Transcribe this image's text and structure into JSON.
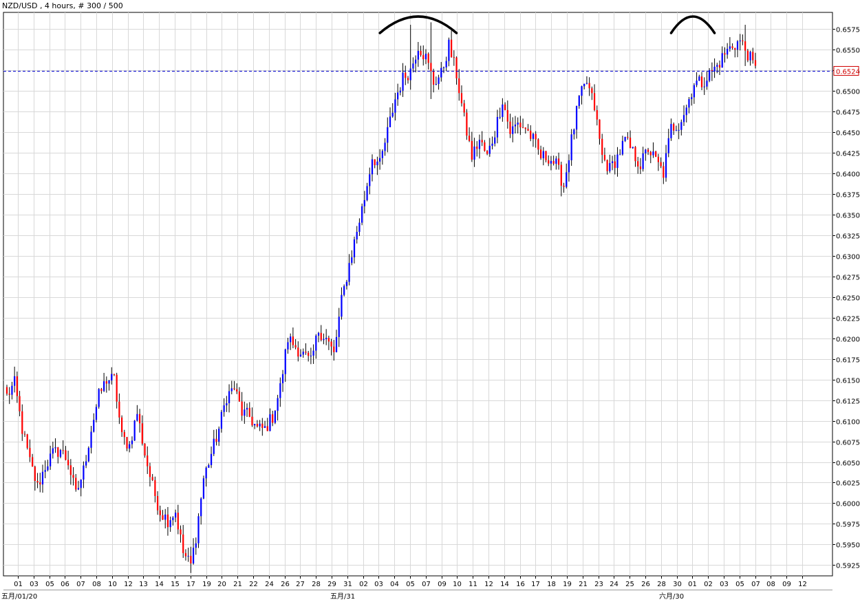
{
  "header": {
    "title": "NZD/USD , 4 hours, # 300 / 500"
  },
  "colors": {
    "background": "#ffffff",
    "grid": "#d8d8d8",
    "bull": "#0000ff",
    "bear": "#ff0000",
    "wick": "#000000",
    "price_line": "#0000cc",
    "price_label": "#d00000",
    "annotation": "#000000"
  },
  "chart_data": {
    "type": "candlestick",
    "symbol": "NZD/USD",
    "timeframe": "4 hours",
    "ylim": [
      0.5912,
      0.6595
    ],
    "grid": true,
    "yticks": [
      "0.6575",
      "0.6550",
      "0.6525",
      "0.6500",
      "0.6475",
      "0.6450",
      "0.6425",
      "0.6400",
      "0.6375",
      "0.6350",
      "0.6325",
      "0.6300",
      "0.6275",
      "0.6250",
      "0.6225",
      "0.6200",
      "0.6175",
      "0.6150",
      "0.6125",
      "0.6100",
      "0.6075",
      "0.6050",
      "0.6025",
      "0.6000",
      "0.5975",
      "0.5950",
      "0.5925"
    ],
    "current_price": "0.6524",
    "xticks": [
      "01",
      "03",
      "05",
      "06",
      "07",
      "08",
      "10",
      "12",
      "13",
      "14",
      "15",
      "17",
      "19",
      "20",
      "21",
      "22",
      "24",
      "26",
      "27",
      "28",
      "29",
      "31",
      "02",
      "03",
      "04",
      "05",
      "07",
      "09",
      "10",
      "11",
      "12",
      "14",
      "16",
      "17",
      "18",
      "19",
      "21",
      "23",
      "24",
      "25",
      "26",
      "28",
      "30",
      "01",
      "02",
      "03",
      "05",
      "07",
      "08",
      "09",
      "12"
    ],
    "xticks_secondary": [
      "五月/01/20",
      "五月/31",
      "六月/30"
    ],
    "waypoints": [
      [
        0,
        0.613
      ],
      [
        3,
        0.6145
      ],
      [
        6,
        0.609
      ],
      [
        9,
        0.605
      ],
      [
        12,
        0.602
      ],
      [
        15,
        0.6045
      ],
      [
        18,
        0.606
      ],
      [
        21,
        0.6065
      ],
      [
        24,
        0.605
      ],
      [
        27,
        0.601
      ],
      [
        30,
        0.604
      ],
      [
        33,
        0.609
      ],
      [
        36,
        0.613
      ],
      [
        39,
        0.615
      ],
      [
        42,
        0.615
      ],
      [
        45,
        0.608
      ],
      [
        48,
        0.607
      ],
      [
        51,
        0.611
      ],
      [
        54,
        0.606
      ],
      [
        57,
        0.602
      ],
      [
        60,
        0.599
      ],
      [
        63,
        0.598
      ],
      [
        66,
        0.599
      ],
      [
        69,
        0.594
      ],
      [
        72,
        0.5925
      ],
      [
        74,
        0.596
      ],
      [
        77,
        0.603
      ],
      [
        80,
        0.606
      ],
      [
        83,
        0.609
      ],
      [
        86,
        0.613
      ],
      [
        89,
        0.614
      ],
      [
        92,
        0.611
      ],
      [
        95,
        0.6105
      ],
      [
        98,
        0.609
      ],
      [
        101,
        0.609
      ],
      [
        104,
        0.6105
      ],
      [
        107,
        0.614
      ],
      [
        110,
        0.62
      ],
      [
        113,
        0.619
      ],
      [
        116,
        0.618
      ],
      [
        119,
        0.617
      ],
      [
        122,
        0.621
      ],
      [
        125,
        0.62
      ],
      [
        128,
        0.618
      ],
      [
        131,
        0.6245
      ],
      [
        134,
        0.629
      ],
      [
        137,
        0.633
      ],
      [
        140,
        0.637
      ],
      [
        143,
        0.642
      ],
      [
        146,
        0.641
      ],
      [
        149,
        0.645
      ],
      [
        152,
        0.649
      ],
      [
        155,
        0.6515
      ],
      [
        158,
        0.6525
      ],
      [
        161,
        0.6555
      ],
      [
        164,
        0.654
      ],
      [
        167,
        0.651
      ],
      [
        170,
        0.652
      ],
      [
        173,
        0.6555
      ],
      [
        176,
        0.652
      ],
      [
        179,
        0.6465
      ],
      [
        182,
        0.642
      ],
      [
        185,
        0.644
      ],
      [
        188,
        0.642
      ],
      [
        191,
        0.645
      ],
      [
        194,
        0.649
      ],
      [
        197,
        0.645
      ],
      [
        200,
        0.646
      ],
      [
        203,
        0.6455
      ],
      [
        206,
        0.644
      ],
      [
        209,
        0.642
      ],
      [
        212,
        0.642
      ],
      [
        215,
        0.641
      ],
      [
        218,
        0.6385
      ],
      [
        221,
        0.644
      ],
      [
        224,
        0.649
      ],
      [
        227,
        0.651
      ],
      [
        230,
        0.648
      ],
      [
        233,
        0.642
      ],
      [
        236,
        0.6405
      ],
      [
        239,
        0.642
      ],
      [
        242,
        0.644
      ],
      [
        245,
        0.6425
      ],
      [
        248,
        0.641
      ],
      [
        251,
        0.643
      ],
      [
        254,
        0.6415
      ],
      [
        257,
        0.64
      ],
      [
        260,
        0.6455
      ],
      [
        263,
        0.646
      ],
      [
        266,
        0.648
      ],
      [
        269,
        0.651
      ],
      [
        272,
        0.651
      ],
      [
        275,
        0.652
      ],
      [
        278,
        0.653
      ],
      [
        281,
        0.6545
      ],
      [
        284,
        0.6555
      ],
      [
        287,
        0.656
      ],
      [
        290,
        0.6545
      ],
      [
        293,
        0.6525
      ]
    ],
    "highlights": [
      {
        "index": 158,
        "high": 0.658,
        "low": 0.651
      },
      {
        "index": 166,
        "high": 0.6583,
        "low": 0.649
      },
      {
        "index": 72,
        "low": 0.592,
        "high": 0.5945
      },
      {
        "index": 217,
        "low": 0.6372,
        "high": 0.64
      },
      {
        "index": 289,
        "high": 0.658,
        "low": 0.653
      }
    ],
    "annotations": [
      {
        "type": "arc",
        "description": "double top marker",
        "from_index": 146,
        "to_index": 176,
        "peak": 0.6595
      },
      {
        "type": "arc",
        "description": "double top marker",
        "from_index": 260,
        "to_index": 277,
        "peak": 0.6595
      }
    ]
  }
}
